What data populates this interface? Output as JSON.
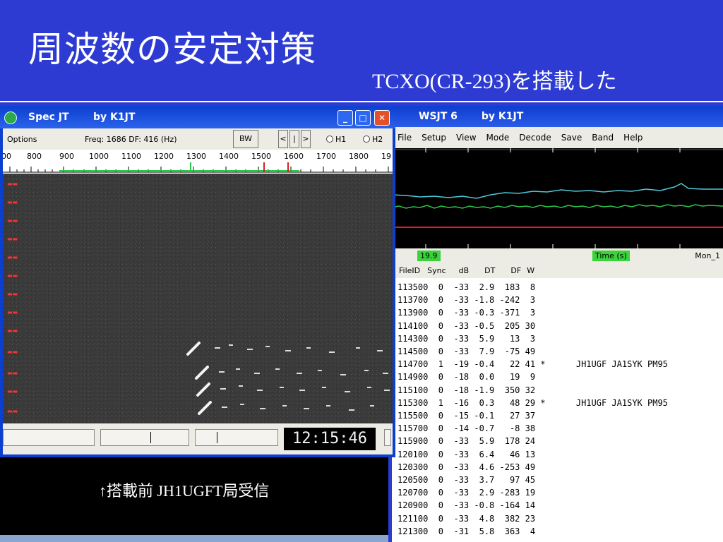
{
  "slide": {
    "title": "周波数の安定対策",
    "subtitle": "TCXO(CR-293)を搭載した",
    "caption": "↑搭載前 JH1UGFT局受信"
  },
  "specjt": {
    "title": "Spec JT",
    "by": "by K1JT",
    "toolbar": {
      "options": "Options",
      "freq": "Freq: 1686  DF:  416  (Hz)",
      "bw": "BW",
      "lt": "<",
      "bar": "|",
      "gt": ">",
      "h1": "H1",
      "h2": "H2"
    },
    "ruler_labels": [
      "00",
      "800",
      "900",
      "1000",
      "1100",
      "1200",
      "1300",
      "1400",
      "1500",
      "1600",
      "1700",
      "1800",
      "19"
    ],
    "clock": "12:15:46"
  },
  "wsjt": {
    "title": "WSJT 6",
    "by": "by K1JT",
    "menu": [
      "File",
      "Setup",
      "View",
      "Mode",
      "Decode",
      "Save",
      "Band",
      "Help"
    ],
    "status_left": "19.9",
    "status_mid": "Time (s)",
    "status_right": "Mon_1",
    "headers": [
      "FileID",
      "Sync",
      "dB",
      "DT",
      "DF",
      "W"
    ],
    "rows": [
      "113500  0  -33  2.9  183  8",
      "113700  0  -33 -1.8 -242  3",
      "113900  0  -33 -0.3 -371  3",
      "114100  0  -33 -0.5  205 30",
      "114300  0  -33  5.9   13  3",
      "114500  0  -33  7.9  -75 49",
      "114700  1  -19 -0.4   22 41 *      JH1UGF JA1SYK PM95",
      "114900  0  -18  0.0   19  9",
      "115100  0  -18 -1.9  350 32",
      "115300  1  -16  0.3   48 29 *      JH1UGF JA1SYK PM95",
      "115500  0  -15 -0.1   27 37",
      "115700  0  -14 -0.7   -8 38",
      "115900  0  -33  5.9  178 24",
      "120100  0  -33  6.4   46 13",
      "120300  0  -33  4.6 -253 49",
      "120500  0  -33  3.7   97 45",
      "120700  0  -33  2.9 -283 19",
      "120900  0  -33 -0.8 -164 14",
      "121100  0  -33  4.8  382 23",
      "121300  0  -31  5.8  363  4"
    ]
  },
  "colors": {
    "slide_bg": "#2d3bd3",
    "xp_title": "#0b3fcf",
    "trace_cyan": "#4fc8d8",
    "trace_green": "#2cc84a",
    "trace_red": "#d82020",
    "status_green": "#3cd23c"
  }
}
